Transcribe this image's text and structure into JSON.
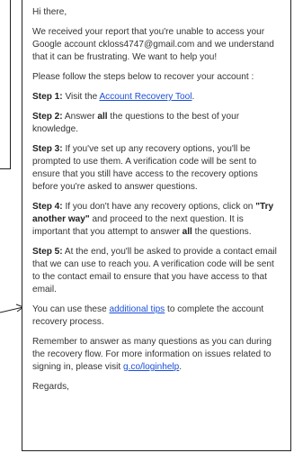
{
  "message": {
    "greeting": "Hi there,",
    "p1": "We received your report that you're unable to access your Google account ckloss4747@gmail.com and we understand that it can be frustrating. We want to help you!",
    "p2": "Please follow the steps below to recover your account :",
    "step1": {
      "label": "Step 1:",
      "text": " Visit the ",
      "link": "Account Recovery Tool",
      "end": "."
    },
    "step2": {
      "label": "Step 2:",
      "text_a": " Answer ",
      "bold": "all",
      "text_b": " the questions to the best of your knowledge."
    },
    "step3": {
      "label": "Step 3:",
      "text": " If you've set up any recovery options, you'll be prompted to use them. A verification code will be sent to ensure that you still have access to the recovery options before you're asked to answer questions."
    },
    "step4": {
      "label": "Step 4:",
      "text_a": " If you don't have any recovery options, click on ",
      "bold_a": "\"Try another way\"",
      "text_b": " and proceed to the next question. It is important that you attempt to answer ",
      "bold_b": "all",
      "text_c": " the questions."
    },
    "step5": {
      "label": "Step 5:",
      "text": " At the end, you'll be asked to provide a contact email that we can use to reach you. A verification code will be sent to the contact email to ensure that you have access to that email."
    },
    "tips": {
      "text_a": "You can use these ",
      "link": "additional tips",
      "text_b": " to complete the account recovery process."
    },
    "remember": {
      "text": "Remember to answer as many questions as you can during the recovery flow. For more information on issues related to signing in, please visit ",
      "link": "g.co/loginhelp",
      "end": "."
    },
    "closing": "Regards,"
  }
}
